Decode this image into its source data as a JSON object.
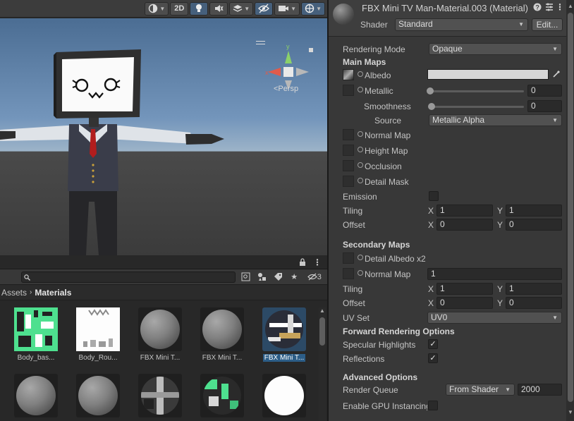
{
  "scene": {
    "toolbar": {
      "mode_2d_label": "2D",
      "persp_label": "<Persp"
    },
    "gizmo_axes": {
      "y": "y",
      "x": "x"
    }
  },
  "project": {
    "layer_count": "3",
    "search": {
      "value": "",
      "placeholder": ""
    },
    "breadcrumb": [
      "Assets",
      "Materials"
    ],
    "assets": [
      {
        "label": "Body_bas...",
        "kind": "texture-green"
      },
      {
        "label": "Body_Rou...",
        "kind": "texture-white"
      },
      {
        "label": "FBX Mini T...",
        "kind": "sphere"
      },
      {
        "label": "FBX Mini T...",
        "kind": "sphere"
      },
      {
        "label": "FBX Mini T...",
        "kind": "sphere-tv",
        "selected": true
      },
      {
        "label": "",
        "kind": "sphere"
      },
      {
        "label": "",
        "kind": "sphere"
      },
      {
        "label": "",
        "kind": "sphere-dark"
      },
      {
        "label": "",
        "kind": "sphere-green"
      },
      {
        "label": "",
        "kind": "sphere-white"
      }
    ]
  },
  "inspector": {
    "title": "FBX Mini TV Man-Material.003 (Material)",
    "shader_label": "Shader",
    "shader_value": "Standard",
    "edit_label": "Edit...",
    "rendering_mode_label": "Rendering Mode",
    "rendering_mode_value": "Opaque",
    "main_maps_label": "Main Maps",
    "albedo_label": "Albedo",
    "metallic_label": "Metallic",
    "metallic_value": "0",
    "smoothness_label": "Smoothness",
    "smoothness_value": "0",
    "source_label": "Source",
    "source_value": "Metallic Alpha",
    "normal_map_label": "Normal Map",
    "height_map_label": "Height Map",
    "occlusion_label": "Occlusion",
    "detail_mask_label": "Detail Mask",
    "emission_label": "Emission",
    "tiling_label": "Tiling",
    "offset_label": "Offset",
    "x_label": "X",
    "y_label": "Y",
    "main_tiling": {
      "x": "1",
      "y": "1"
    },
    "main_offset": {
      "x": "0",
      "y": "0"
    },
    "secondary_maps_label": "Secondary Maps",
    "detail_albedo_label": "Detail Albedo x2",
    "secondary_normal_label": "Normal Map",
    "secondary_normal_value": "1",
    "secondary_tiling": {
      "x": "1",
      "y": "1"
    },
    "secondary_offset": {
      "x": "0",
      "y": "0"
    },
    "uv_set_label": "UV Set",
    "uv_set_value": "UV0",
    "forward_label": "Forward Rendering Options",
    "specular_label": "Specular Highlights",
    "reflections_label": "Reflections",
    "advanced_label": "Advanced Options",
    "render_queue_label": "Render Queue",
    "render_queue_mode": "From Shader",
    "render_queue_value": "2000",
    "gpu_instancing_label": "Enable GPU Instancing"
  }
}
